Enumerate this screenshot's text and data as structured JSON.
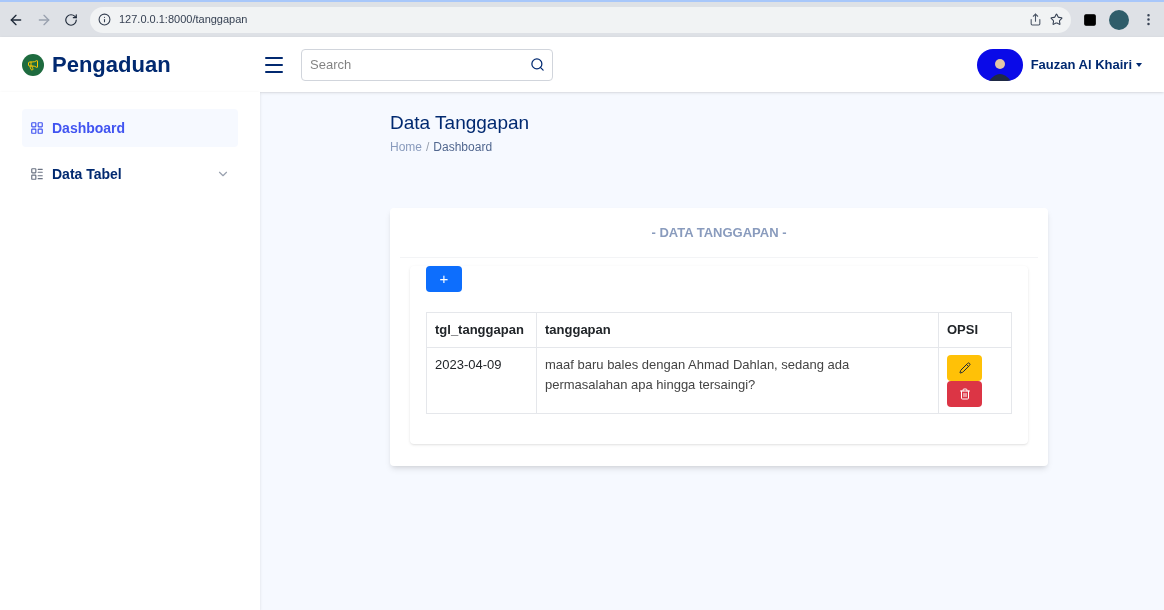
{
  "browser": {
    "url": "127.0.0.1:8000/tanggapan"
  },
  "header": {
    "brand": "Pengaduan",
    "search": {
      "placeholder": "Search"
    },
    "user": "Fauzan Al Khairi"
  },
  "sidebar": {
    "items": [
      {
        "label": "Dashboard",
        "selected": true,
        "kind": "link"
      },
      {
        "label": "Data Tabel",
        "selected": false,
        "kind": "group"
      }
    ]
  },
  "page": {
    "title": "Data Tanggapan",
    "breadcrumb": [
      "Home",
      "Dashboard"
    ],
    "breadcrumb_separator": "/"
  },
  "card": {
    "title": "- DATA TANGGAPAN -",
    "add_button": "+",
    "table": {
      "columns": [
        "tgl_tanggapan",
        "tanggapan",
        "OPSI"
      ],
      "rows": [
        {
          "tgl_tanggapan": "2023-04-09",
          "tanggapan": "maaf baru bales dengan Ahmad Dahlan, sedang ada permasalahan apa hingga tersaingi?"
        }
      ]
    }
  }
}
